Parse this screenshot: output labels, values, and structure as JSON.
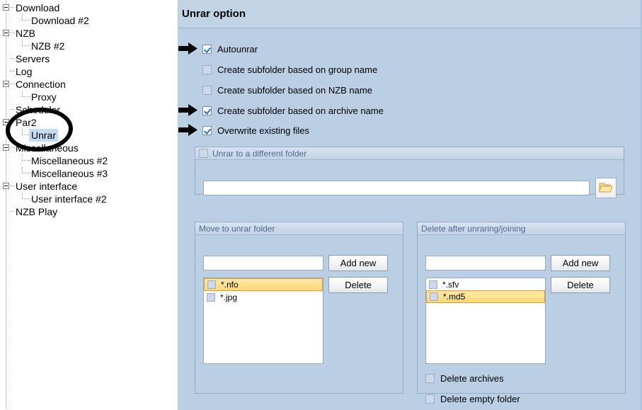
{
  "window": {
    "title": "Unrar option"
  },
  "sidebar": {
    "items": [
      {
        "label": "Download",
        "level": 1,
        "expandable": true,
        "selected": false
      },
      {
        "label": "Download #2",
        "level": 2,
        "expandable": false,
        "selected": false
      },
      {
        "label": "NZB",
        "level": 1,
        "expandable": true,
        "selected": false
      },
      {
        "label": "NZB #2",
        "level": 2,
        "expandable": false,
        "selected": false
      },
      {
        "label": "Servers",
        "level": 1,
        "expandable": false,
        "selected": false
      },
      {
        "label": "Log",
        "level": 1,
        "expandable": false,
        "selected": false
      },
      {
        "label": "Connection",
        "level": 1,
        "expandable": true,
        "selected": false
      },
      {
        "label": "Proxy",
        "level": 2,
        "expandable": false,
        "selected": false
      },
      {
        "label": "Scheduler",
        "level": 1,
        "expandable": false,
        "selected": false
      },
      {
        "label": "Par2",
        "level": 1,
        "expandable": true,
        "selected": false
      },
      {
        "label": "Unrar",
        "level": 2,
        "expandable": false,
        "selected": true
      },
      {
        "label": "Miscellaneous",
        "level": 1,
        "expandable": true,
        "selected": false
      },
      {
        "label": "Miscellaneous #2",
        "level": 2,
        "expandable": false,
        "selected": false
      },
      {
        "label": "Miscellaneous #3",
        "level": 2,
        "expandable": false,
        "selected": false
      },
      {
        "label": "User interface",
        "level": 1,
        "expandable": true,
        "selected": false
      },
      {
        "label": "User interface #2",
        "level": 2,
        "expandable": false,
        "selected": false
      },
      {
        "label": "NZB Play",
        "level": 1,
        "expandable": false,
        "selected": false
      }
    ]
  },
  "annotations": {
    "circle_target": "Unrar",
    "arrow_targets": [
      "Autounrar",
      "Create subfolder based on archive name",
      "Overwrite existing files"
    ]
  },
  "options": {
    "checkboxes": [
      {
        "label": "Autounrar",
        "checked": true,
        "arrow": true
      },
      {
        "label": "Create subfolder based on group name",
        "checked": false,
        "arrow": false
      },
      {
        "label": "Create subfolder based on NZB name",
        "checked": false,
        "arrow": false
      },
      {
        "label": "Create subfolder based on archive name",
        "checked": true,
        "arrow": true
      },
      {
        "label": "Overwrite existing files",
        "checked": true,
        "arrow": true
      }
    ]
  },
  "unrar_folder_group": {
    "title": "Unrar to a different folder",
    "enabled": false,
    "path_value": "",
    "path_placeholder": "",
    "browse_icon": "folder-open-icon"
  },
  "move_group": {
    "title": "Move to unrar folder",
    "input_value": "",
    "input_placeholder": "",
    "add_button": "Add new",
    "delete_button": "Delete",
    "items": [
      {
        "label": "*.nfo",
        "checked": false,
        "selected": true
      },
      {
        "label": "*.jpg",
        "checked": false,
        "selected": false
      }
    ]
  },
  "delete_group": {
    "title": "Delete after unraring/joining",
    "input_value": "",
    "input_placeholder": "",
    "add_button": "Add new",
    "delete_button": "Delete",
    "items": [
      {
        "label": "*.sfv",
        "checked": false,
        "selected": false
      },
      {
        "label": "*.md5",
        "checked": false,
        "selected": true
      }
    ],
    "extra_checkboxes": [
      {
        "label": "Delete archives",
        "checked": false
      },
      {
        "label": "Delete empty folder",
        "checked": false
      }
    ]
  },
  "colors": {
    "panel_bg": "#bacee4",
    "title_bg": "#c2d3e6",
    "selection_yellow": "#ffd978",
    "tree_selection": "#c5dbf2",
    "group_title": "#4d6a8c"
  }
}
